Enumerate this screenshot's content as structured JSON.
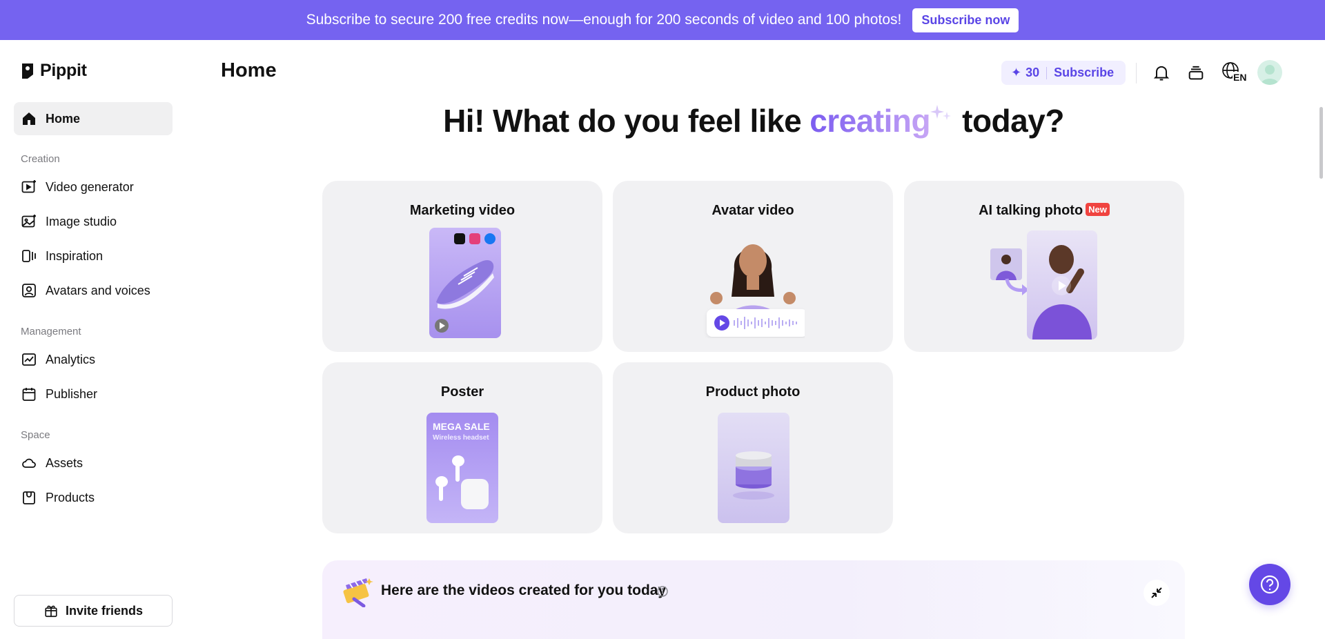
{
  "banner": {
    "text": "Subscribe to secure 200 free credits now—enough for 200 seconds of video and 100 photos!",
    "button": "Subscribe now"
  },
  "brand": {
    "name": "Pippit"
  },
  "sidebar": {
    "home": "Home",
    "sections": {
      "creation": "Creation",
      "management": "Management",
      "space": "Space"
    },
    "items": {
      "video_generator": "Video generator",
      "image_studio": "Image studio",
      "inspiration": "Inspiration",
      "avatars_voices": "Avatars and voices",
      "analytics": "Analytics",
      "publisher": "Publisher",
      "assets": "Assets",
      "products": "Products"
    },
    "invite": "Invite friends"
  },
  "header": {
    "title": "Home",
    "credits": "30",
    "subscribe": "Subscribe",
    "language": "EN"
  },
  "greeting": {
    "before": "Hi! What do you feel like",
    "highlight": "creating",
    "after": "today?"
  },
  "cards": {
    "marketing_video": "Marketing video",
    "avatar_video": "Avatar video",
    "ai_talking_photo": "AI talking photo",
    "new_badge": "New",
    "poster": "Poster",
    "poster_headline": "MEGA SALE",
    "poster_sub": "Wireless headset",
    "product_photo": "Product photo"
  },
  "videos_panel": {
    "title": "Here are the videos created for you today"
  },
  "colors": {
    "accent": "#7563f0",
    "accent_dark": "#5a45e6",
    "card_bg": "#f1f1f3",
    "new_badge": "#f0433f"
  }
}
